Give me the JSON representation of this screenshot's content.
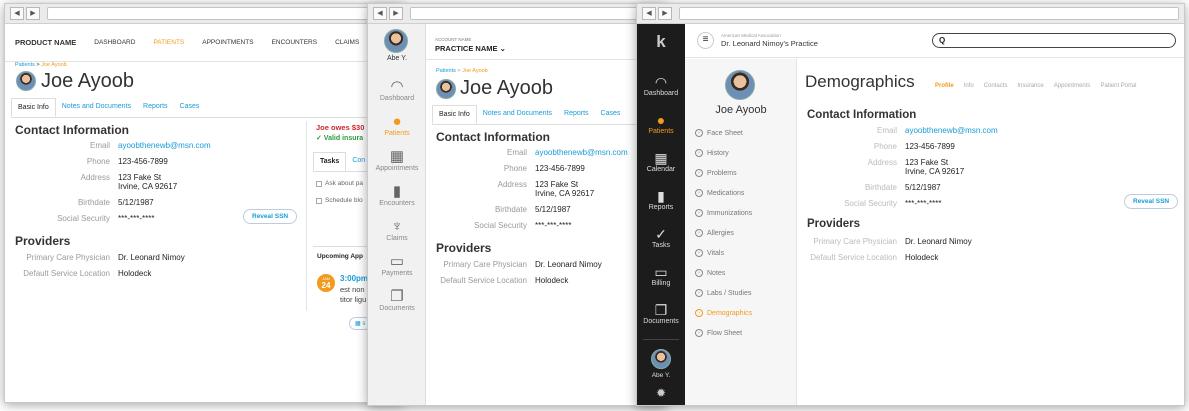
{
  "patient": {
    "name": "Joe Ayoob",
    "breadcrumb_root": "Patients",
    "breadcrumb_sep": ">",
    "breadcrumb_current": "Joe Ayoob",
    "email": "ayoobthenewb@msn.com",
    "phone": "123-456-7899",
    "address_line1": "123 Fake St",
    "address_line2": "Irvine, CA 92617",
    "birthdate": "5/12/1987",
    "ssn": "***-***-****",
    "pcp": "Dr. Leonard Nimoy",
    "location": "Holodeck"
  },
  "labels": {
    "email": "Email",
    "phone": "Phone",
    "address": "Address",
    "birthdate": "Birthdate",
    "ssn": "Social Security",
    "pcp": "Primary Care Physician",
    "location": "Default Service Location",
    "contact_heading": "Contact Information",
    "providers_heading": "Providers",
    "reveal_ssn": "Reveal SSN"
  },
  "w1": {
    "product": "PRODUCT NAME",
    "nav": [
      "DASHBOARD",
      "PATIENTS",
      "APPOINTMENTS",
      "ENCOUNTERS",
      "CLAIMS"
    ],
    "tabs": [
      "Basic Info",
      "Notes and Documents",
      "Reports",
      "Cases"
    ],
    "owes": "Joe owes $30",
    "insurance": "✓ Valid insura",
    "task_tabs": [
      "Tasks",
      "Con"
    ],
    "tasks": [
      "Ask about pa",
      "Schedule blo"
    ],
    "upcoming": "Upcoming App",
    "appt_month": "JAN",
    "appt_day": "24",
    "appt_time": "3:00pm",
    "appt_text1": "est non",
    "appt_text2": "titor ligu",
    "appt_btn": "s"
  },
  "w2": {
    "user": "Abe Y.",
    "account_label": "ACCOUNT NAME",
    "practice": "PRACTICE NAME",
    "side": [
      {
        "icon": "◠",
        "label": "Dashboard"
      },
      {
        "icon": "●",
        "label": "Patients"
      },
      {
        "icon": "▦",
        "label": "Appointments"
      },
      {
        "icon": "▮",
        "label": "Encounters"
      },
      {
        "icon": "♆",
        "label": "Claims"
      },
      {
        "icon": "▭",
        "label": "Payments"
      },
      {
        "icon": "❐",
        "label": "Documents"
      }
    ],
    "tabs": [
      "Basic Info",
      "Notes and Documents",
      "Reports",
      "Cases"
    ]
  },
  "w3": {
    "org": "American Medical Association",
    "practice": "Dr. Leonard Nimoy's Practice",
    "search_icon": "Q",
    "side": [
      {
        "icon": "◠",
        "label": "Dashboard"
      },
      {
        "icon": "●",
        "label": "Patients"
      },
      {
        "icon": "▦",
        "label": "Calendar"
      },
      {
        "icon": "▮",
        "label": "Reports"
      },
      {
        "icon": "✓",
        "label": "Tasks"
      },
      {
        "icon": "▭",
        "label": "Billing"
      },
      {
        "icon": "❐",
        "label": "Documents"
      }
    ],
    "user": "Abe Y.",
    "settings_icon": "✹",
    "menu": [
      "Face Sheet",
      "History",
      "Problems",
      "Medications",
      "Immunizations",
      "Allergies",
      "Vitals",
      "Notes",
      "Labs / Studies",
      "Demographics",
      "Flow Sheet"
    ],
    "section": "Demographics",
    "subtabs": [
      "Profile",
      "Info",
      "Contacts",
      "Insurance",
      "Appointments",
      "Patient Portal"
    ]
  },
  "colors": {
    "accent": "#f29a1d",
    "link": "#1a9bd7",
    "dark_sidebar": "#1c1c1c"
  }
}
